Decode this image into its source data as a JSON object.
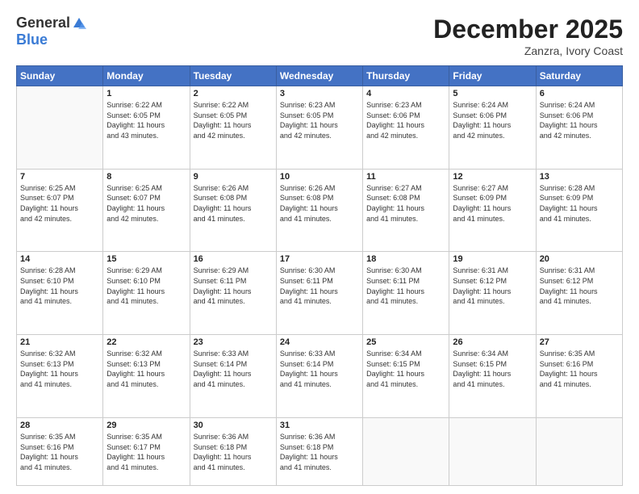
{
  "header": {
    "logo_general": "General",
    "logo_blue": "Blue",
    "month": "December 2025",
    "location": "Zanzra, Ivory Coast"
  },
  "days_of_week": [
    "Sunday",
    "Monday",
    "Tuesday",
    "Wednesday",
    "Thursday",
    "Friday",
    "Saturday"
  ],
  "weeks": [
    [
      {
        "day": "",
        "info": ""
      },
      {
        "day": "1",
        "info": "Sunrise: 6:22 AM\nSunset: 6:05 PM\nDaylight: 11 hours\nand 43 minutes."
      },
      {
        "day": "2",
        "info": "Sunrise: 6:22 AM\nSunset: 6:05 PM\nDaylight: 11 hours\nand 42 minutes."
      },
      {
        "day": "3",
        "info": "Sunrise: 6:23 AM\nSunset: 6:05 PM\nDaylight: 11 hours\nand 42 minutes."
      },
      {
        "day": "4",
        "info": "Sunrise: 6:23 AM\nSunset: 6:06 PM\nDaylight: 11 hours\nand 42 minutes."
      },
      {
        "day": "5",
        "info": "Sunrise: 6:24 AM\nSunset: 6:06 PM\nDaylight: 11 hours\nand 42 minutes."
      },
      {
        "day": "6",
        "info": "Sunrise: 6:24 AM\nSunset: 6:06 PM\nDaylight: 11 hours\nand 42 minutes."
      }
    ],
    [
      {
        "day": "7",
        "info": "Sunrise: 6:25 AM\nSunset: 6:07 PM\nDaylight: 11 hours\nand 42 minutes."
      },
      {
        "day": "8",
        "info": "Sunrise: 6:25 AM\nSunset: 6:07 PM\nDaylight: 11 hours\nand 42 minutes."
      },
      {
        "day": "9",
        "info": "Sunrise: 6:26 AM\nSunset: 6:08 PM\nDaylight: 11 hours\nand 41 minutes."
      },
      {
        "day": "10",
        "info": "Sunrise: 6:26 AM\nSunset: 6:08 PM\nDaylight: 11 hours\nand 41 minutes."
      },
      {
        "day": "11",
        "info": "Sunrise: 6:27 AM\nSunset: 6:08 PM\nDaylight: 11 hours\nand 41 minutes."
      },
      {
        "day": "12",
        "info": "Sunrise: 6:27 AM\nSunset: 6:09 PM\nDaylight: 11 hours\nand 41 minutes."
      },
      {
        "day": "13",
        "info": "Sunrise: 6:28 AM\nSunset: 6:09 PM\nDaylight: 11 hours\nand 41 minutes."
      }
    ],
    [
      {
        "day": "14",
        "info": "Sunrise: 6:28 AM\nSunset: 6:10 PM\nDaylight: 11 hours\nand 41 minutes."
      },
      {
        "day": "15",
        "info": "Sunrise: 6:29 AM\nSunset: 6:10 PM\nDaylight: 11 hours\nand 41 minutes."
      },
      {
        "day": "16",
        "info": "Sunrise: 6:29 AM\nSunset: 6:11 PM\nDaylight: 11 hours\nand 41 minutes."
      },
      {
        "day": "17",
        "info": "Sunrise: 6:30 AM\nSunset: 6:11 PM\nDaylight: 11 hours\nand 41 minutes."
      },
      {
        "day": "18",
        "info": "Sunrise: 6:30 AM\nSunset: 6:11 PM\nDaylight: 11 hours\nand 41 minutes."
      },
      {
        "day": "19",
        "info": "Sunrise: 6:31 AM\nSunset: 6:12 PM\nDaylight: 11 hours\nand 41 minutes."
      },
      {
        "day": "20",
        "info": "Sunrise: 6:31 AM\nSunset: 6:12 PM\nDaylight: 11 hours\nand 41 minutes."
      }
    ],
    [
      {
        "day": "21",
        "info": "Sunrise: 6:32 AM\nSunset: 6:13 PM\nDaylight: 11 hours\nand 41 minutes."
      },
      {
        "day": "22",
        "info": "Sunrise: 6:32 AM\nSunset: 6:13 PM\nDaylight: 11 hours\nand 41 minutes."
      },
      {
        "day": "23",
        "info": "Sunrise: 6:33 AM\nSunset: 6:14 PM\nDaylight: 11 hours\nand 41 minutes."
      },
      {
        "day": "24",
        "info": "Sunrise: 6:33 AM\nSunset: 6:14 PM\nDaylight: 11 hours\nand 41 minutes."
      },
      {
        "day": "25",
        "info": "Sunrise: 6:34 AM\nSunset: 6:15 PM\nDaylight: 11 hours\nand 41 minutes."
      },
      {
        "day": "26",
        "info": "Sunrise: 6:34 AM\nSunset: 6:15 PM\nDaylight: 11 hours\nand 41 minutes."
      },
      {
        "day": "27",
        "info": "Sunrise: 6:35 AM\nSunset: 6:16 PM\nDaylight: 11 hours\nand 41 minutes."
      }
    ],
    [
      {
        "day": "28",
        "info": "Sunrise: 6:35 AM\nSunset: 6:16 PM\nDaylight: 11 hours\nand 41 minutes."
      },
      {
        "day": "29",
        "info": "Sunrise: 6:35 AM\nSunset: 6:17 PM\nDaylight: 11 hours\nand 41 minutes."
      },
      {
        "day": "30",
        "info": "Sunrise: 6:36 AM\nSunset: 6:18 PM\nDaylight: 11 hours\nand 41 minutes."
      },
      {
        "day": "31",
        "info": "Sunrise: 6:36 AM\nSunset: 6:18 PM\nDaylight: 11 hours\nand 41 minutes."
      },
      {
        "day": "",
        "info": ""
      },
      {
        "day": "",
        "info": ""
      },
      {
        "day": "",
        "info": ""
      }
    ]
  ]
}
